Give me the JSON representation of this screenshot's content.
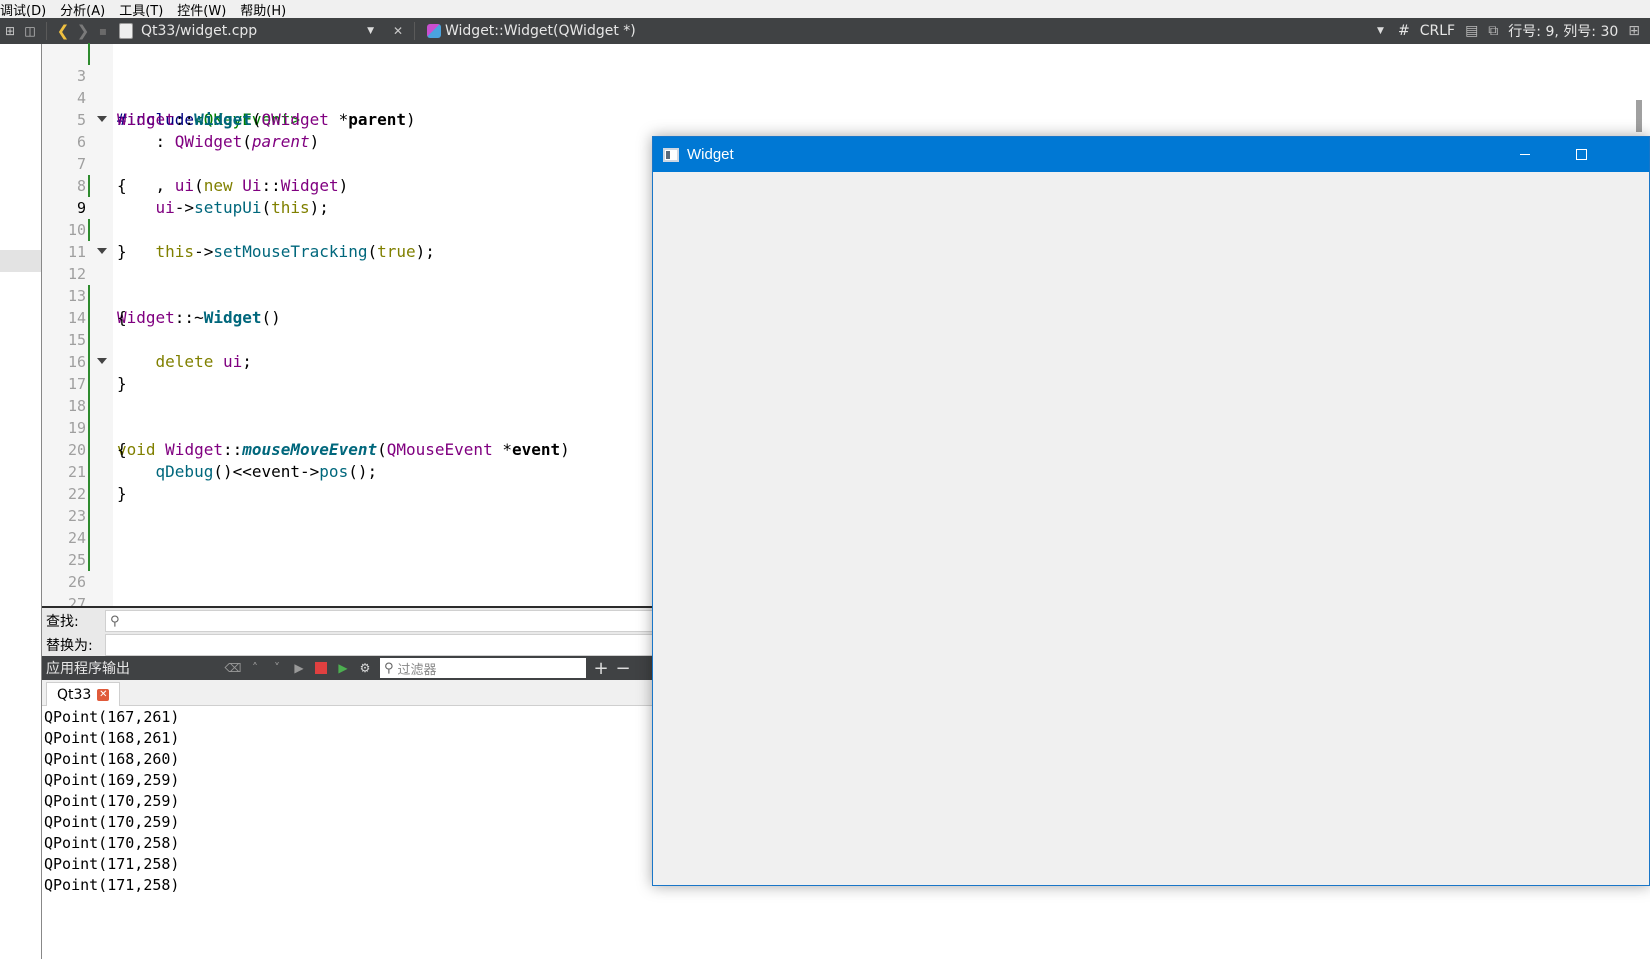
{
  "menubar": {
    "items": [
      "调试(D)",
      "分析(A)",
      "工具(T)",
      "控件(W)",
      "帮助(H)"
    ]
  },
  "toolbar": {
    "file_name": "Qt33/widget.cpp",
    "function_name": "Widget::Widget(QWidget *)",
    "hash_label": "#",
    "line_ending": "CRLF",
    "cursor_position": "行号: 9, 列号: 30"
  },
  "editor": {
    "current_line": "9",
    "lines": [
      {
        "n": "3"
      },
      {
        "n": "4"
      },
      {
        "n": "5"
      },
      {
        "n": "6"
      },
      {
        "n": "7"
      },
      {
        "n": "8"
      },
      {
        "n": "9"
      },
      {
        "n": "10"
      },
      {
        "n": "11"
      },
      {
        "n": "12"
      },
      {
        "n": "13"
      },
      {
        "n": "14"
      },
      {
        "n": "15"
      },
      {
        "n": "16"
      },
      {
        "n": "17"
      },
      {
        "n": "18"
      },
      {
        "n": "19"
      },
      {
        "n": "20"
      },
      {
        "n": "21"
      },
      {
        "n": "22"
      },
      {
        "n": "23"
      },
      {
        "n": "24"
      },
      {
        "n": "25"
      },
      {
        "n": "26"
      },
      {
        "n": "27"
      }
    ]
  },
  "findbar": {
    "find_label": "查找:",
    "replace_label": "替换为:",
    "find_value": "",
    "replace_value": ""
  },
  "output": {
    "title": "应用程序输出",
    "filter_placeholder": "过滤器",
    "tab_label": "Qt33",
    "lines": [
      "QPoint(167,261)",
      "QPoint(168,261)",
      "QPoint(168,260)",
      "QPoint(169,259)",
      "QPoint(170,259)",
      "QPoint(170,259)",
      "QPoint(170,258)",
      "QPoint(171,258)",
      "QPoint(171,258)"
    ]
  },
  "widget_window": {
    "title": "Widget",
    "accent_color": "#0078d4"
  },
  "colors": {
    "toolbar_bg": "#404244",
    "keyword": "#808000",
    "class": "#800080",
    "function": "#00677c",
    "include": "#008000"
  }
}
